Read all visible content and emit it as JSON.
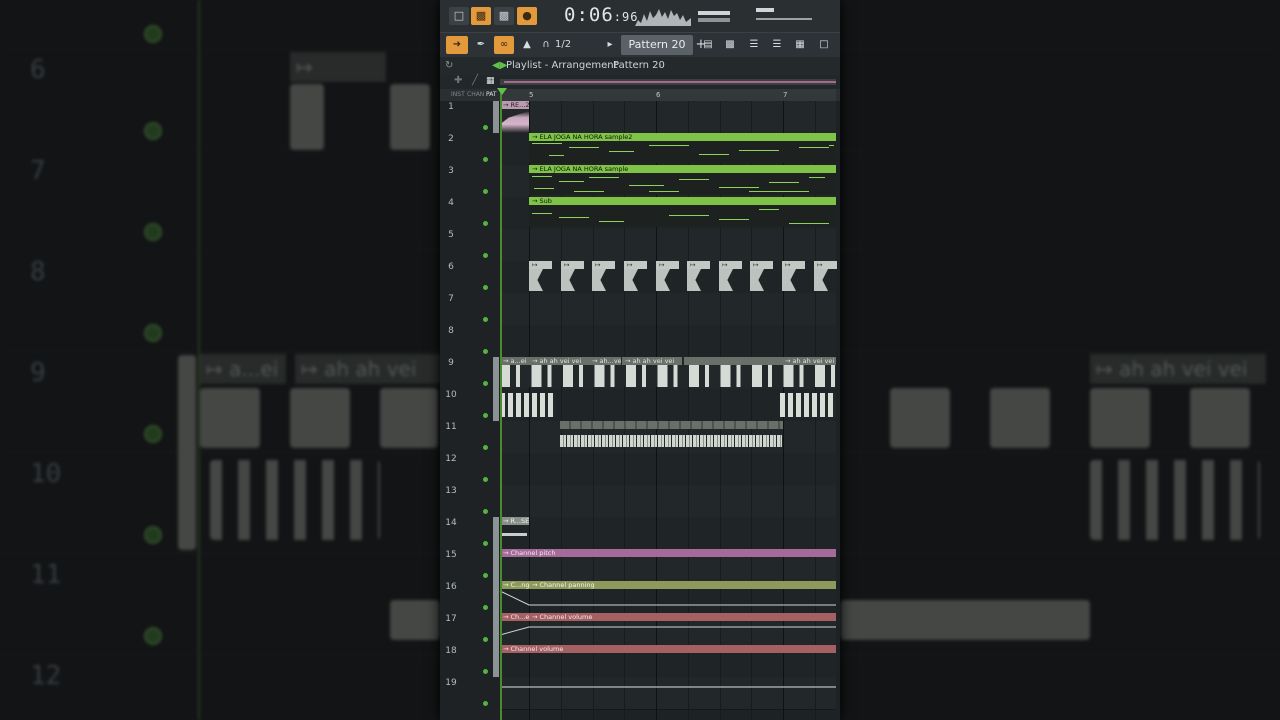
{
  "background": {
    "track_numbers": [
      "6",
      "7",
      "8",
      "9",
      "10",
      "11",
      "12"
    ],
    "clip_labels": [
      "a...ei",
      "ah ah vei vei",
      "ah ah vei vei"
    ]
  },
  "toolbar": {
    "time": "0:06",
    "time_fraction": ":96",
    "snap_label": "1/2 step",
    "pattern_label": "Pattern 20",
    "plus_label": "+"
  },
  "breadcrumb": {
    "title": "Playlist - Arrangement",
    "separator": "›",
    "pattern": "Pattern 20",
    "trailing": "›"
  },
  "header": {
    "inst": "INST",
    "chan": "CHAN",
    "pat": "PAT"
  },
  "ruler": {
    "marks": [
      "5",
      "6",
      "7"
    ]
  },
  "tracks": [
    {
      "num": "1",
      "clips": [
        {
          "label": "RE...2"
        }
      ]
    },
    {
      "num": "2",
      "clips": [
        {
          "label": "ELA JOGA NA HORA sample2"
        }
      ]
    },
    {
      "num": "3",
      "clips": [
        {
          "label": "ELA JOGA NA HORA sample"
        }
      ]
    },
    {
      "num": "4",
      "clips": [
        {
          "label": "Sub"
        }
      ]
    },
    {
      "num": "5",
      "clips": []
    },
    {
      "num": "6",
      "clips": []
    },
    {
      "num": "7",
      "clips": []
    },
    {
      "num": "8",
      "clips": []
    },
    {
      "num": "9",
      "clips": [
        {
          "label": "a...ei"
        },
        {
          "label": "ah ah vei vei"
        },
        {
          "label": "ah...vei"
        },
        {
          "label": "ah ah vei vei"
        },
        {
          "label": "ah ah vei vei"
        },
        {
          "label": "ah ah vei vei"
        }
      ]
    },
    {
      "num": "10",
      "clips": []
    },
    {
      "num": "11",
      "clips": []
    },
    {
      "num": "12",
      "clips": []
    },
    {
      "num": "13",
      "clips": []
    },
    {
      "num": "14",
      "clips": [
        {
          "label": "R...SE"
        }
      ]
    },
    {
      "num": "15",
      "clips": [
        {
          "label": "Channel pitch"
        }
      ]
    },
    {
      "num": "16",
      "clips": [
        {
          "label": "C...ng"
        },
        {
          "label": "Channel panning"
        }
      ]
    },
    {
      "num": "17",
      "clips": [
        {
          "label": "Ch...e"
        },
        {
          "label": "Channel volume"
        }
      ]
    },
    {
      "num": "18",
      "clips": [
        {
          "label": "Channel volume"
        }
      ]
    },
    {
      "num": "19",
      "clips": []
    }
  ],
  "colors": {
    "accent_orange": "#e39a3c",
    "clip_green": "#7fc447",
    "clip_pink": "#d3a6c4",
    "clip_gray": "#9da39e",
    "auto_purple": "#a46a9a",
    "auto_olive": "#8d9a5c",
    "auto_red": "#a56063"
  }
}
